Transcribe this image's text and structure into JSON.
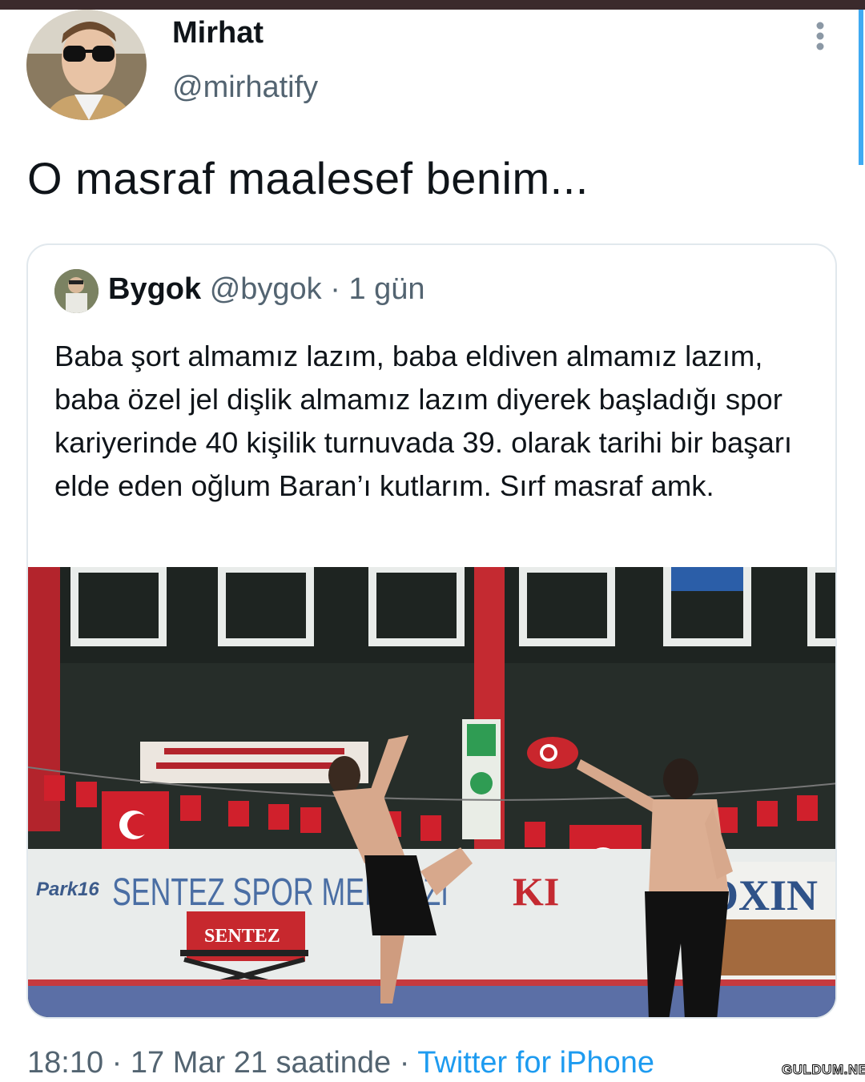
{
  "tweet": {
    "author": {
      "display_name": "Mirhat",
      "handle": "@mirhatify"
    },
    "more_icon": "more-vertical-icon",
    "text": "O masraf maalesef benim...",
    "quoted": {
      "author": {
        "display_name": "Bygok",
        "handle": "@bygok"
      },
      "separator": "·",
      "time": "1 gün",
      "text": "Baba şort almamız lazım, baba eldiven almamız lazım, baba özel jel dişlik almamız lazım diyerek başladığı spor kariyerinde 40 kişilik turnuvada 39. olarak tarihi bir başarı elde eden oğlum Baran’ı kutlarım. Sırf masraf amk.",
      "media": {
        "wall_sign_left": "SENTEZ SPOR MERKEZI",
        "wall_sign_right_a": "KI",
        "wall_sign_right_b": "OXIN",
        "park_logo": "Park16",
        "bench_sign": "SENTEZ"
      }
    },
    "footer": {
      "time": "18:10",
      "separator": "·",
      "date": "17 Mar 21 saatinde",
      "source": "Twitter for iPhone"
    }
  },
  "watermark": "GULDUM.NET",
  "colors": {
    "text": "#0f1419",
    "muted": "#536471",
    "link": "#1d9bf0",
    "border": "#e1e8ed",
    "flag_red": "#d0202c"
  }
}
